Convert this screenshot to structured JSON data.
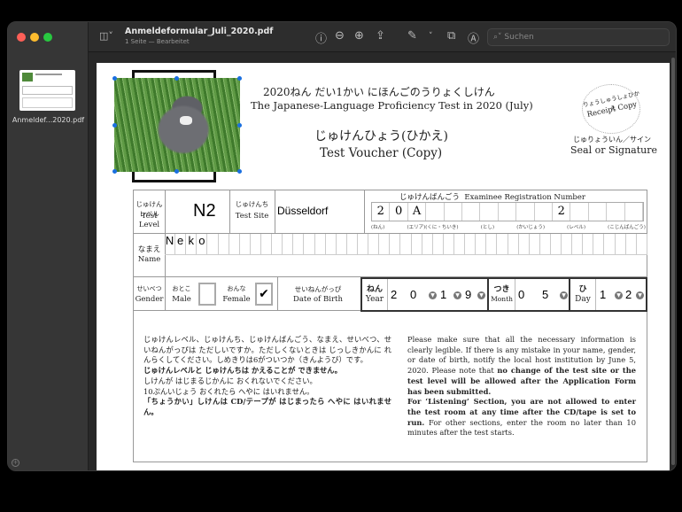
{
  "window": {
    "title": "Anmeldeformular_Juli_2020.pdf",
    "subtitle": "1 Seite — Bearbeitet",
    "search_placeholder": "Suchen"
  },
  "sidebar": {
    "thumbnail_label": "Anmeldef...2020.pdf"
  },
  "doc": {
    "title_jp": "2020ねん だい1かい にほんごのうりょくしけん",
    "title_en": "The Japanese-Language Proficiency Test in 2020 (July)",
    "voucher_jp": "じゅけんひょう(ひかえ)",
    "voucher_en": "Test Voucher (Copy)",
    "receipt_jp": "りょうしゅうしょひかえ",
    "receipt_en": "Receipt Copy",
    "seal_jp": "じゅりょういん／サイン",
    "seal_en": "Seal or Signature",
    "level_jp": "じゅけんレベル",
    "level_en": "Test Level",
    "level_value": "N2",
    "site_jp": "じゅけんち",
    "site_en": "Test Site",
    "site_value": "Düsseldorf",
    "reg_jp": "じゅけんばんごう",
    "reg_en": "Examinee Registration Number",
    "reg_cells": [
      "2",
      "0",
      "A",
      "",
      "",
      "",
      "",
      "",
      "",
      "",
      "2",
      "",
      "",
      "",
      ""
    ],
    "reg_labels": [
      "(ねん)",
      "(エリア)(くに・ちいき)",
      "(とし)",
      "(かいじょう)",
      "(レベル)",
      "(こじんばんごう)"
    ],
    "name_jp": "なまえ",
    "name_en": "Name",
    "name_chars": [
      "N",
      "e",
      "k",
      "o"
    ],
    "gender_jp": "せいべつ",
    "gender_en": "Gender",
    "male_jp": "おとこ",
    "male_en": "Male",
    "male_checked": false,
    "female_jp": "おんな",
    "female_en": "Female",
    "female_checked": true,
    "check_mark": "✔",
    "dob_jp": "せいねんがっぴ",
    "dob_en": "Date of Birth",
    "year_jp": "ねん",
    "year_en": "Year",
    "year_digits": [
      "2",
      "0",
      "1",
      "9"
    ],
    "month_jp": "つき",
    "month_en": "Month",
    "month_digits": [
      "0",
      "5"
    ],
    "day_jp": "ひ",
    "day_en": "Day",
    "day_digits": [
      "1",
      "2"
    ],
    "notice_jp": [
      "じゅけんレベル、じゅけんち、じゅけんばんごう、なまえ、せいべつ、せいねんがっぴは ただしいですか。ただしくないときは じっしきかんに れんらくしてください。しめきりは6がついつか（きんようび）です。"
    ],
    "notice_jp_bold1": "じゅけんレベルと じゅけんちは かえることが できません。",
    "notice_jp_2": "しけんが はじまるじかんに おくれないでください。",
    "notice_jp_3": "10ぷんいじょう おくれたら へやに はいれません。",
    "notice_jp_bold2": "「ちょうかい」しけんは CD/テープが はじまったら へやに はいれません。",
    "notice_en_1": "Please make sure that all the necessary information is clearly legible. If there is any mistake in your name, gender, or date of birth, notify the local host institution by June 5, 2020. Please note that ",
    "notice_en_b1": "no change of the test site or the test level will be allowed after the Application Form has been submitted.",
    "notice_en_b2": "For ‘Listening’ Section, you are not allowed to enter the test room at any time after the CD/tape is set to run.",
    "notice_en_2": " For other sections, enter the room no later than 10 minutes after the test starts."
  }
}
